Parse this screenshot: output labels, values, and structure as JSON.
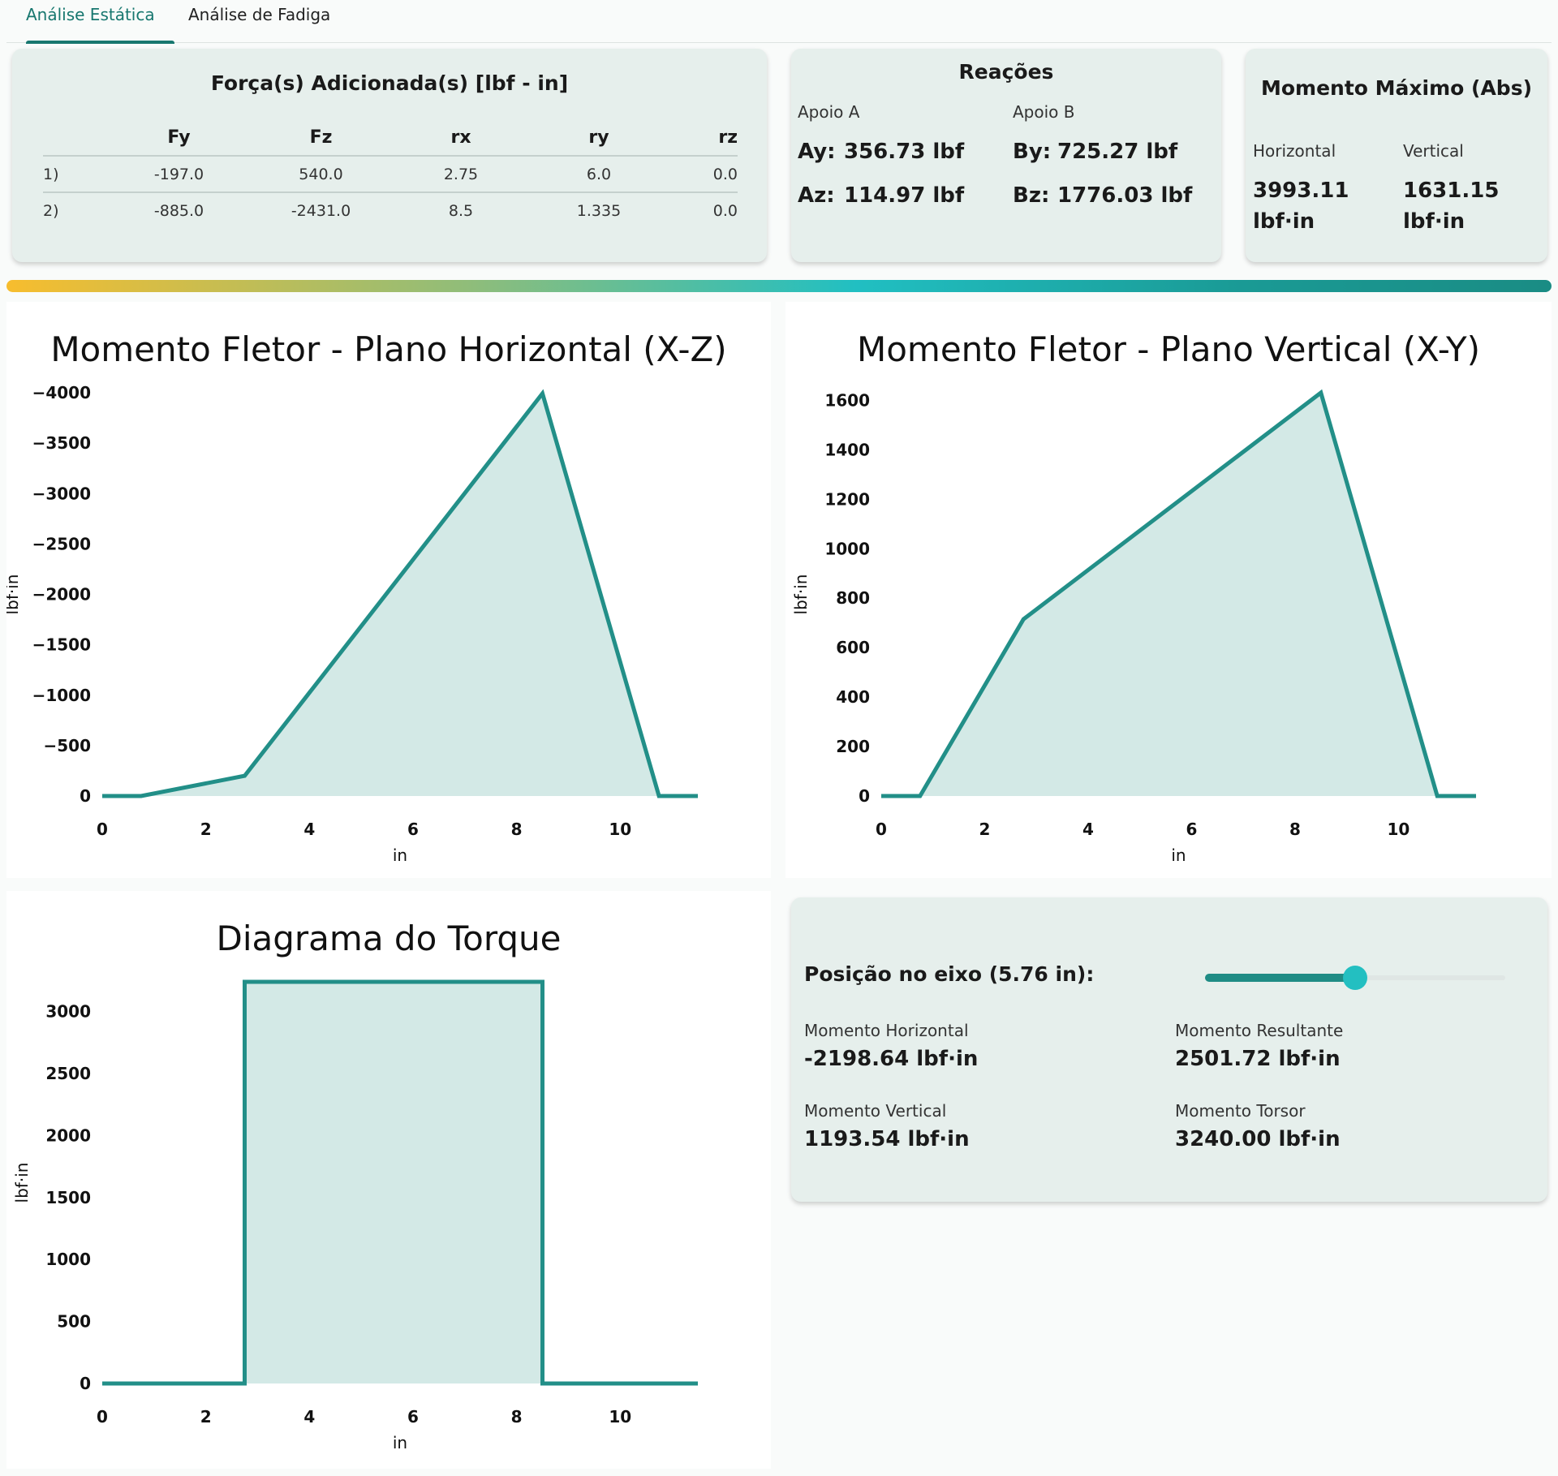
{
  "tabs": [
    {
      "label": "Análise Estática",
      "active": true
    },
    {
      "label": "Análise de Fadiga",
      "active": false
    }
  ],
  "forces": {
    "title": "Força(s) Adicionada(s) [lbf - in]",
    "columns": [
      "",
      "Fy",
      "Fz",
      "rx",
      "ry",
      "rz"
    ],
    "rows": [
      [
        "1)",
        "-197.0",
        "540.0",
        "2.75",
        "6.0",
        "0.0"
      ],
      [
        "2)",
        "-885.0",
        "-2431.0",
        "8.5",
        "1.335",
        "0.0"
      ]
    ]
  },
  "reactions": {
    "title": "Reações",
    "support_a": {
      "label": "Apoio A",
      "y_key": "Ay:",
      "y_val": "356.73 lbf",
      "z_key": "Az:",
      "z_val": "114.97 lbf"
    },
    "support_b": {
      "label": "Apoio B",
      "y_key": "By:",
      "y_val": "725.27 lbf",
      "z_key": "Bz:",
      "z_val": "1776.03 lbf"
    }
  },
  "max_moment": {
    "title": "Momento Máximo (Abs)",
    "horizontal": {
      "label": "Horizontal",
      "value": "3993.11",
      "unit": "lbf·in"
    },
    "vertical": {
      "label": "Vertical",
      "value": "1631.15",
      "unit": "lbf·in"
    }
  },
  "position_panel": {
    "label": "Posição no eixo (5.76 in):",
    "slider_fraction": 0.5,
    "items": {
      "horizontal": {
        "label": "Momento Horizontal",
        "value": "-2198.64 lbf·in"
      },
      "resultant": {
        "label": "Momento Resultante",
        "value": "2501.72 lbf·in"
      },
      "vertical": {
        "label": "Momento Vertical",
        "value": "1193.54 lbf·in"
      },
      "torque": {
        "label": "Momento Torsor",
        "value": "3240.00 lbf·in"
      }
    }
  },
  "colors": {
    "line": "#228f88",
    "fill": "#d3e9e6"
  },
  "chart_data": [
    {
      "id": "horizontal",
      "type": "area",
      "title": "Momento Fletor - Plano Horizontal (X-Z)",
      "xlabel": "in",
      "ylabel": "lbf·in",
      "x": [
        0,
        0.75,
        2.75,
        8.5,
        10.75,
        11.5
      ],
      "y": [
        0,
        0,
        -200,
        -3993.11,
        0,
        0
      ],
      "xlim": [
        0,
        11.5
      ],
      "ylim": [
        0,
        -4000
      ],
      "xticks": [
        0,
        2,
        4,
        6,
        8,
        10
      ],
      "yticks": [
        0,
        -500,
        -1000,
        -1500,
        -2000,
        -2500,
        -3000,
        -3500,
        -4000
      ],
      "grid": false
    },
    {
      "id": "vertical",
      "type": "area",
      "title": "Momento Fletor - Plano Vertical (X-Y)",
      "xlabel": "in",
      "ylabel": "lbf·in",
      "x": [
        0,
        0.75,
        2.75,
        8.5,
        10.75,
        11.5
      ],
      "y": [
        0,
        0,
        715,
        1631.15,
        0,
        0
      ],
      "xlim": [
        0,
        11.5
      ],
      "ylim": [
        0,
        1631.15
      ],
      "xticks": [
        0,
        2,
        4,
        6,
        8,
        10
      ],
      "yticks": [
        0,
        200,
        400,
        600,
        800,
        1000,
        1200,
        1400,
        1600
      ],
      "grid": false
    },
    {
      "id": "torque",
      "type": "area",
      "title": "Diagrama do Torque",
      "xlabel": "in",
      "ylabel": "lbf·in",
      "x": [
        0,
        2.75,
        2.75,
        8.5,
        8.5,
        11.5
      ],
      "y": [
        0,
        0,
        3240,
        3240,
        0,
        0
      ],
      "xlim": [
        0,
        11.5
      ],
      "ylim": [
        0,
        3240
      ],
      "xticks": [
        0,
        2,
        4,
        6,
        8,
        10
      ],
      "yticks": [
        0,
        500,
        1000,
        1500,
        2000,
        2500,
        3000
      ],
      "grid": false
    }
  ]
}
